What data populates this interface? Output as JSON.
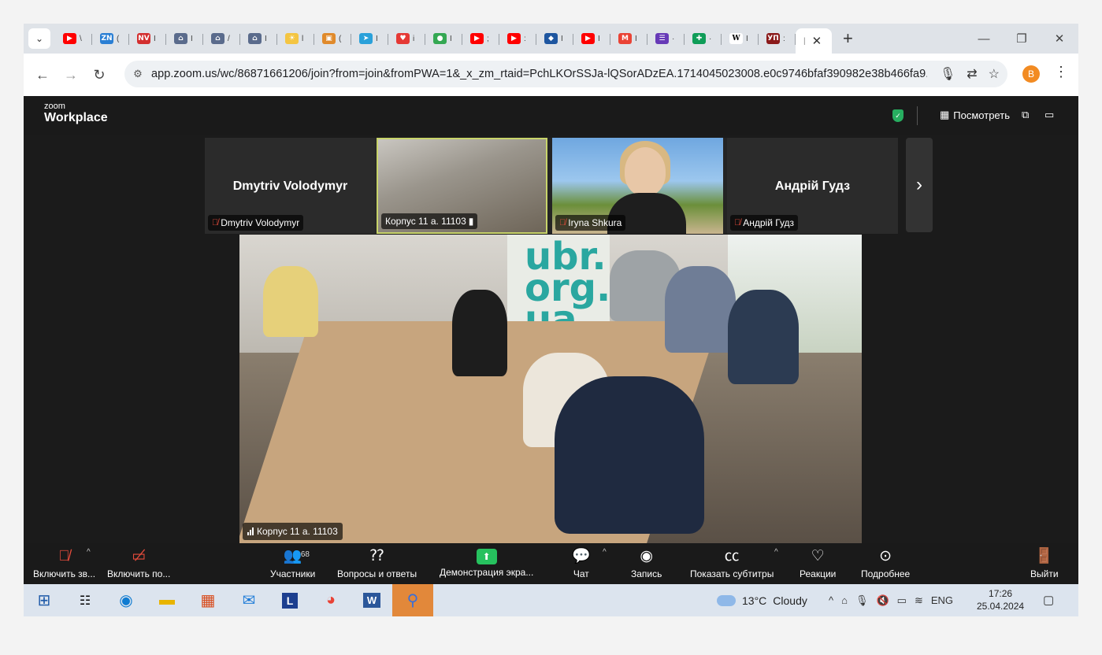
{
  "browser": {
    "tabs": [
      {
        "icon": "youtube-icon",
        "color": "#ff0000",
        "glyph": "▶",
        "text": "\\"
      },
      {
        "icon": "zn-icon",
        "color": "#2a7fd4",
        "glyph": "ZN",
        "text": "("
      },
      {
        "icon": "nv-icon",
        "color": "#d32f2f",
        "glyph": "NV",
        "text": "I"
      },
      {
        "icon": "gov-icon",
        "color": "#5a6b8c",
        "glyph": "⌂",
        "text": "I"
      },
      {
        "icon": "gov-icon",
        "color": "#5a6b8c",
        "glyph": "⌂",
        "text": "/"
      },
      {
        "icon": "gov-icon",
        "color": "#5a6b8c",
        "glyph": "⌂",
        "text": "I"
      },
      {
        "icon": "sun-icon",
        "color": "#f4c542",
        "glyph": "☀",
        "text": "l"
      },
      {
        "icon": "box-icon",
        "color": "#e08a2b",
        "glyph": "▣",
        "text": "("
      },
      {
        "icon": "telegram-icon",
        "color": "#2aa1da",
        "glyph": "➤",
        "text": "I"
      },
      {
        "icon": "heart-icon",
        "color": "#e53935",
        "glyph": "♥",
        "text": "i"
      },
      {
        "icon": "maps-icon",
        "color": "#34a853",
        "glyph": "●",
        "text": "I"
      },
      {
        "icon": "youtube-icon",
        "color": "#ff0000",
        "glyph": "▶",
        "text": ";"
      },
      {
        "icon": "youtube-icon",
        "color": "#ff0000",
        "glyph": "▶",
        "text": ":"
      },
      {
        "icon": "ukraine-icon",
        "color": "#1e56a0",
        "glyph": "◆",
        "text": "I"
      },
      {
        "icon": "youtube-icon",
        "color": "#ff0000",
        "glyph": "▶",
        "text": "I"
      },
      {
        "icon": "gmail-icon",
        "color": "#ea4335",
        "glyph": "M",
        "text": "I"
      },
      {
        "icon": "forms-icon",
        "color": "#673ab7",
        "glyph": "☰",
        "text": "·"
      },
      {
        "icon": "sheets-icon",
        "color": "#0f9d58",
        "glyph": "✚",
        "text": "·"
      },
      {
        "icon": "wikipedia-icon",
        "color": "#ffffff",
        "glyph": "W",
        "text": "I"
      },
      {
        "icon": "up-icon",
        "color": "#8b1a1a",
        "glyph": "УП",
        "text": ":"
      }
    ],
    "new_tab_label": "+",
    "url": "app.zoom.us/wc/86871661206/join?from=join&fromPWA=1&_x_zm_rtaid=PchLKOrSSJa-lQSorADzEA.1714045023008.e0c9746bfaf390982e38b466fa9...",
    "profile_initial": "B"
  },
  "zoom": {
    "logo_small": "zoom",
    "logo_big": "Workplace",
    "view_label": "Посмотреть",
    "participants": [
      {
        "big_name": "Dmytriv Volodymyr",
        "label": "Dmytriv Volodymyr",
        "muted": true
      },
      {
        "big_name": "",
        "label": "Корпус 11 а. 11103",
        "muted": false
      },
      {
        "big_name": "",
        "label": "Iryna Shkura",
        "muted": true
      },
      {
        "big_name": "Андрій Гудз",
        "label": "Андрій Гудз",
        "muted": true
      }
    ],
    "main_video_label": "Корпус 11 а. 11103",
    "main_banner_text": "ubr.\norg.\nua",
    "toolbar": {
      "audio": "Включить зв...",
      "video": "Включить по...",
      "participants": "Участники",
      "participants_count": "68",
      "qa": "Вопросы и ответы",
      "share": "Демонстрация экра...",
      "chat": "Чат",
      "record": "Запись",
      "captions": "Показать субтитры",
      "reactions": "Реакции",
      "more": "Подробнее",
      "leave": "Выйти"
    }
  },
  "taskbar": {
    "weather_temp": "13°C",
    "weather_text": "Cloudy",
    "language": "ENG",
    "time": "17:26",
    "date": "25.04.2024"
  }
}
